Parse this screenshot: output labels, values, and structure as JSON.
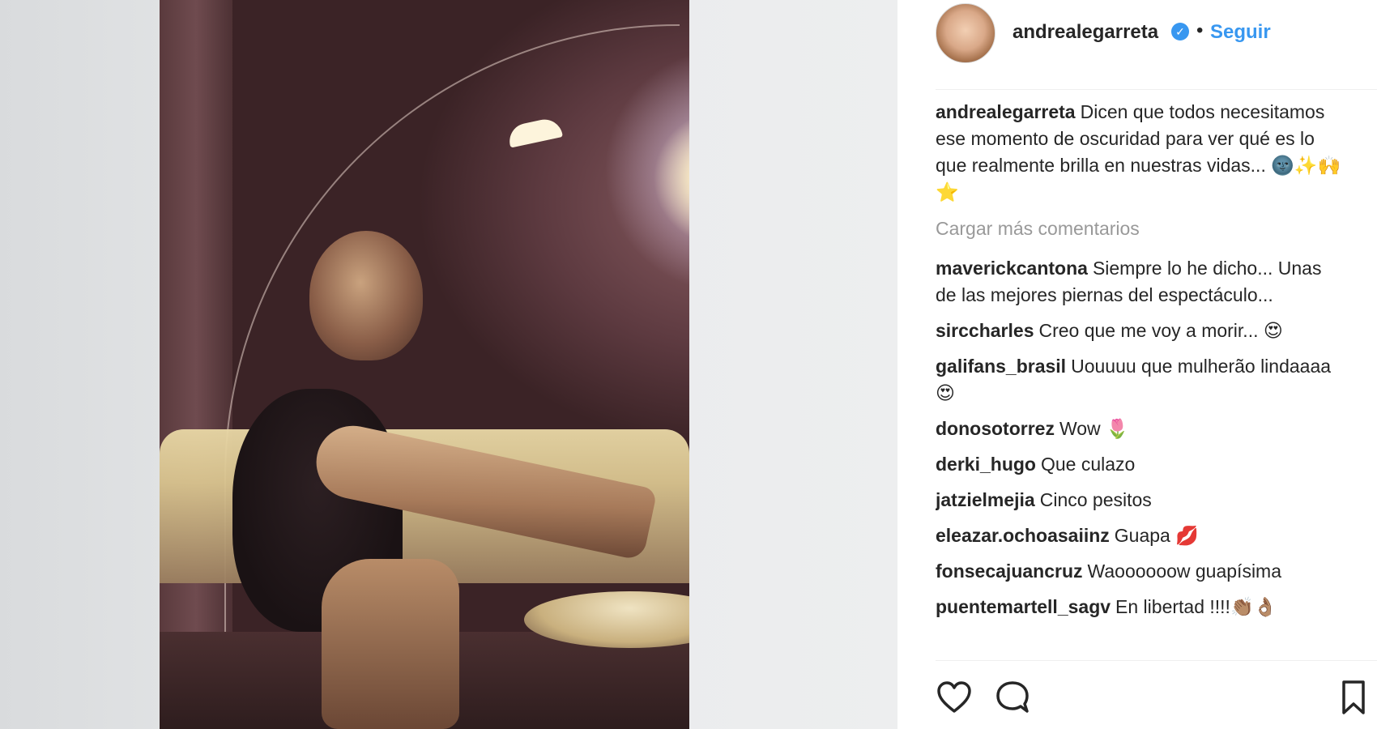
{
  "post": {
    "username": "andrealegarreta",
    "follow_label": "Seguir",
    "separator": "•",
    "verified_glyph": "✓",
    "caption_text": "Dicen que todos necesitamos ese momento de oscuridad para ver qué es lo que realmente brilla en nuestras vidas... 🌚✨🙌⭐"
  },
  "load_more_label": "Cargar más comentarios",
  "comments": [
    {
      "user": "maverickcantona",
      "text": "Siempre lo he dicho... Unas de las mejores piernas del espectáculo..."
    },
    {
      "user": "sirccharles",
      "text": "Creo que me voy a morir... 😍"
    },
    {
      "user": "galifans_brasil",
      "text": "Uouuuu que mulherão lindaaaa😍"
    },
    {
      "user": "donosotorrez",
      "text": "Wow 🌷"
    },
    {
      "user": "derki_hugo",
      "text": "Que culazo"
    },
    {
      "user": "jatzielmejia",
      "text": "Cinco pesitos"
    },
    {
      "user": "eleazar.ochoasaiinz",
      "text": "Guapa 💋"
    },
    {
      "user": "fonsecajuancruz",
      "text": "Waoooooow guapísima"
    },
    {
      "user": "puentemartell_sagv",
      "text": "En libertad !!!!👏🏽👌🏽"
    }
  ],
  "icons": {
    "like": "heart-outline-icon",
    "comment": "speech-bubble-icon",
    "save": "bookmark-icon"
  },
  "colors": {
    "link_blue": "#3897f0",
    "muted_gray": "#999999",
    "text": "#262626"
  }
}
